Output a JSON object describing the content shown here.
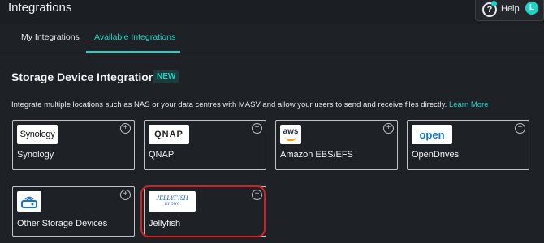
{
  "header": {
    "title": "Integrations",
    "help_label": "Help",
    "avatar_initial": "L"
  },
  "tabs": [
    {
      "label": "My Integrations",
      "active": false
    },
    {
      "label": "Available Integrations",
      "active": true
    }
  ],
  "section": {
    "title": "Storage Device Integration",
    "badge": "NEW",
    "description": "Integrate multiple locations such as NAS or your data centres with MASV and allow your users to send and receive files directly.",
    "learn_more": "Learn More"
  },
  "cards": [
    {
      "label": "Synology",
      "logo_text": "Synology",
      "icon": "synology-logo"
    },
    {
      "label": "QNAP",
      "logo_text": "QNAP",
      "icon": "qnap-logo"
    },
    {
      "label": "Amazon EBS/EFS",
      "logo_text": "aws",
      "icon": "aws-logo"
    },
    {
      "label": "OpenDrives",
      "logo_text": "open",
      "icon": "opendrives-logo"
    },
    {
      "label": "Other Storage Devices",
      "icon": "storage-device-icon"
    },
    {
      "label": "Jellyfish",
      "logo_text": "JELLYFISH",
      "logo_subtext": "BY OWC",
      "icon": "jellyfish-logo"
    }
  ],
  "colors": {
    "background": "#1e2227",
    "accent": "#1ed3c6",
    "highlight": "#d81f1f",
    "link": "#1ed3c6"
  }
}
